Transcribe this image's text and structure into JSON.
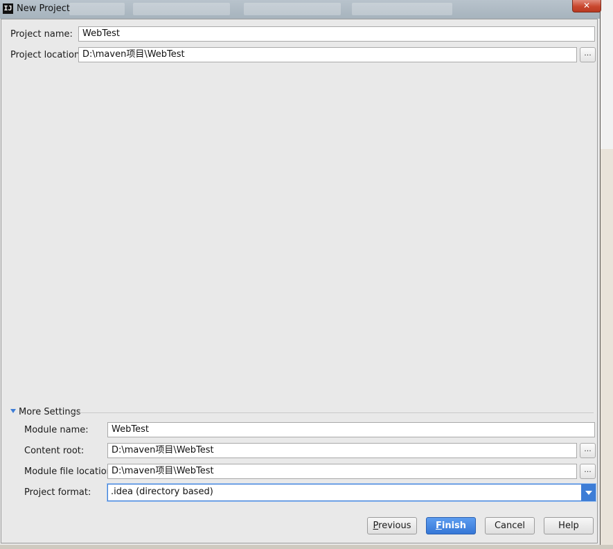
{
  "window": {
    "title": "New Project",
    "close_label": "✕"
  },
  "form": {
    "project_name_label": "Project name:",
    "project_name_value": "WebTest",
    "project_location_label": "Project location:",
    "project_location_value": "D:\\maven项目\\WebTest",
    "browse_label": "..."
  },
  "more_settings": {
    "header": "More Settings",
    "module_name_label": "Module name:",
    "module_name_value": "WebTest",
    "content_root_label": "Content root:",
    "content_root_value": "D:\\maven项目\\WebTest",
    "module_file_location_label": "Module file location:",
    "module_file_location_value": "D:\\maven项目\\WebTest",
    "project_format_label": "Project format:",
    "project_format_value": ".idea (directory based)"
  },
  "buttons": {
    "previous": "Previous",
    "finish": "Finish",
    "cancel": "Cancel",
    "help": "Help"
  },
  "colors": {
    "accent": "#3d7dd6",
    "dialog_background": "#e9e9e9"
  }
}
